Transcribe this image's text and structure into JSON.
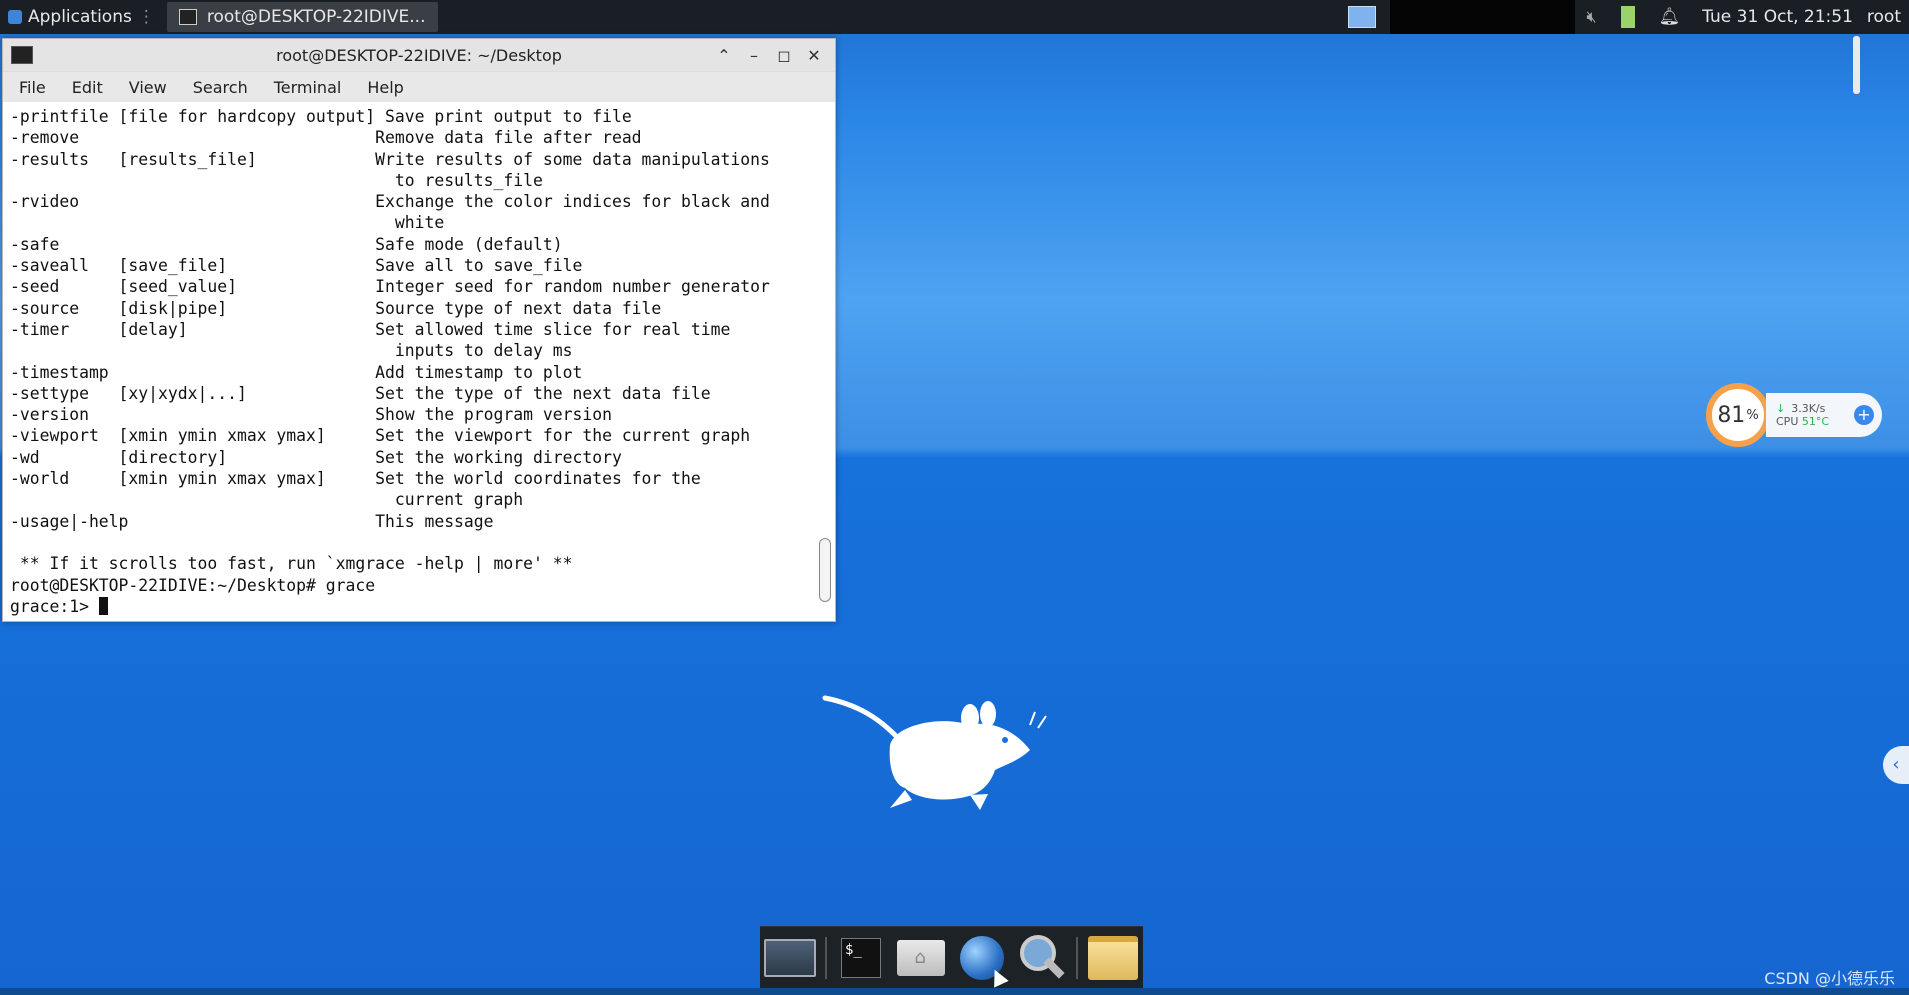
{
  "panel": {
    "applications_label": "Applications",
    "task_title": "root@DESKTOP-22IDIVE...",
    "clock": "Tue 31 Oct, 21:51",
    "user": "root"
  },
  "terminal": {
    "title": "root@DESKTOP-22IDIVE: ~/Desktop",
    "menu": [
      "File",
      "Edit",
      "View",
      "Search",
      "Terminal",
      "Help"
    ],
    "output": "-printfile [file for hardcopy output] Save print output to file\n-remove                              Remove data file after read\n-results   [results_file]            Write results of some data manipulations\n                                       to results_file\n-rvideo                              Exchange the color indices for black and\n                                       white\n-safe                                Safe mode (default)\n-saveall   [save_file]               Save all to save_file\n-seed      [seed_value]              Integer seed for random number generator\n-source    [disk|pipe]               Source type of next data file\n-timer     [delay]                   Set allowed time slice for real time\n                                       inputs to delay ms\n-timestamp                           Add timestamp to plot\n-settype   [xy|xydx|...]             Set the type of the next data file\n-version                             Show the program version\n-viewport  [xmin ymin xmax ymax]     Set the viewport for the current graph\n-wd        [directory]               Set the working directory\n-world     [xmin ymin xmax ymax]     Set the world coordinates for the\n                                       current graph\n-usage|-help                         This message\n\n ** If it scrolls too fast, run `xmgrace -help | more' **\nroot@DESKTOP-22IDIVE:~/Desktop# grace",
    "prompt": "grace:1> "
  },
  "widget": {
    "percent": "81",
    "percent_unit": "%",
    "net_speed": "3.3K/s",
    "cpu_label": "CPU",
    "cpu_temp": "51°C"
  },
  "watermark": "CSDN @小德乐乐",
  "colors": {
    "desktop_blue": "#1772dc",
    "panel_dark": "#1a1f25",
    "gauge_orange": "#f5a04a"
  }
}
